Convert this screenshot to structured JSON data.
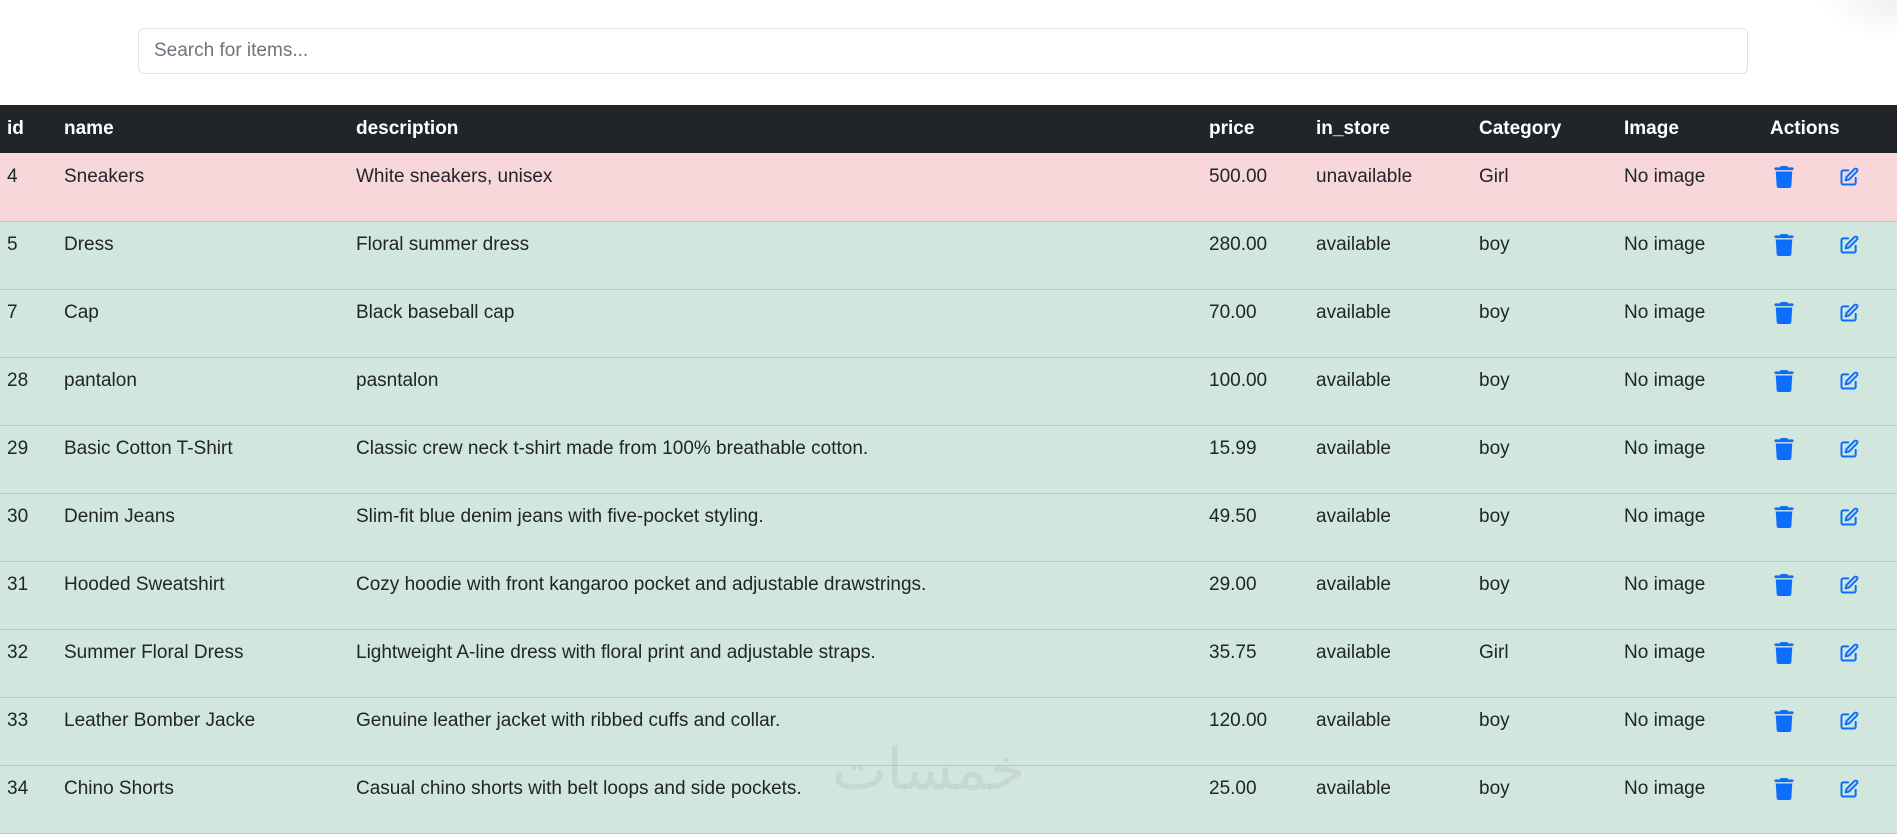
{
  "search": {
    "placeholder": "Search for items...",
    "value": ""
  },
  "table": {
    "columns": [
      "id",
      "name",
      "description",
      "price",
      "in_store",
      "Category",
      "Image",
      "Actions"
    ],
    "rows": [
      {
        "id": "4",
        "name": "Sneakers",
        "description": "White sneakers, unisex",
        "price": "500.00",
        "in_store": "unavailable",
        "category": "Girl",
        "image": "No image",
        "status": "danger"
      },
      {
        "id": "5",
        "name": "Dress",
        "description": "Floral summer dress",
        "price": "280.00",
        "in_store": "available",
        "category": "boy",
        "image": "No image",
        "status": "success"
      },
      {
        "id": "7",
        "name": "Cap",
        "description": "Black baseball cap",
        "price": "70.00",
        "in_store": "available",
        "category": "boy",
        "image": "No image",
        "status": "success"
      },
      {
        "id": "28",
        "name": "pantalon",
        "description": "pasntalon",
        "price": "100.00",
        "in_store": "available",
        "category": "boy",
        "image": "No image",
        "status": "success"
      },
      {
        "id": "29",
        "name": "Basic Cotton T-Shirt",
        "description": "Classic crew neck t-shirt made from 100% breathable cotton.",
        "price": "15.99",
        "in_store": "available",
        "category": "boy",
        "image": "No image",
        "status": "success"
      },
      {
        "id": "30",
        "name": "Denim Jeans",
        "description": "Slim-fit blue denim jeans with five-pocket styling.",
        "price": "49.50",
        "in_store": "available",
        "category": "boy",
        "image": "No image",
        "status": "success"
      },
      {
        "id": "31",
        "name": "Hooded Sweatshirt",
        "description": "Cozy hoodie with front kangaroo pocket and adjustable drawstrings.",
        "price": "29.00",
        "in_store": "available",
        "category": "boy",
        "image": "No image",
        "status": "success"
      },
      {
        "id": "32",
        "name": "Summer Floral Dress",
        "description": "Lightweight A-line dress with floral print and adjustable straps.",
        "price": "35.75",
        "in_store": "available",
        "category": "Girl",
        "image": "No image",
        "status": "success"
      },
      {
        "id": "33",
        "name": "Leather Bomber Jacke",
        "description": "Genuine leather jacket with ribbed cuffs and collar.",
        "price": "120.00",
        "in_store": "available",
        "category": "boy",
        "image": "No image",
        "status": "success"
      },
      {
        "id": "34",
        "name": "Chino Shorts",
        "description": "Casual chino shorts with belt loops and side pockets.",
        "price": "25.00",
        "in_store": "available",
        "category": "boy",
        "image": "No image",
        "status": "success"
      }
    ]
  },
  "icons": {
    "delete": "trash-icon",
    "edit": "edit-icon"
  },
  "colors": {
    "header_bg": "#212529",
    "row_success": "#d1e7dd",
    "row_danger": "#f8d7da",
    "action_icon": "#0d6efd"
  },
  "watermark": "خمسات"
}
